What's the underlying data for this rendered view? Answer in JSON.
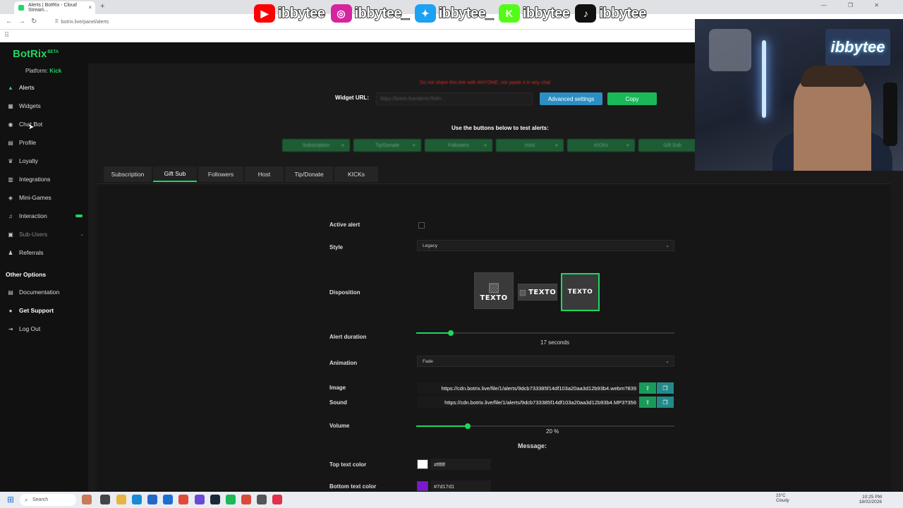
{
  "browser": {
    "tab_title": "Alerts | BotRix - Cloud Stream...",
    "new_tab": "+",
    "tab_close": "×",
    "url": "botrix.live/panel/alerts",
    "window_controls": "— ❐ ✕"
  },
  "social": [
    {
      "icon": "youtube-icon",
      "name": "ibbytee",
      "color": "#ff0000",
      "glyph": "▶"
    },
    {
      "icon": "instagram-icon",
      "name": "ibbytee_",
      "color": "#d6249f",
      "glyph": "◎"
    },
    {
      "icon": "twitter-icon",
      "name": "ibbytee_",
      "color": "#1da1f2",
      "glyph": "✦"
    },
    {
      "icon": "kick-icon",
      "name": "ibbytee",
      "color": "#53fc18",
      "glyph": "K"
    },
    {
      "icon": "tiktok-icon",
      "name": "ibbytee",
      "color": "#111111",
      "glyph": "♪"
    }
  ],
  "webcam": {
    "brand": "ibbytee"
  },
  "app": {
    "logo": "BotRix",
    "logo_badge": "BETA",
    "platform_label": "Platform:",
    "platform_value": "Kick",
    "nav": [
      {
        "label": "Alerts",
        "icon": "triangle-alert-icon",
        "glyph": "▲"
      },
      {
        "label": "Widgets",
        "icon": "widgets-icon",
        "glyph": "▦"
      },
      {
        "label": "Chat Bot",
        "icon": "chat-bot-icon",
        "glyph": "◉"
      },
      {
        "label": "Profile",
        "icon": "profile-icon",
        "glyph": "▤"
      },
      {
        "label": "Loyalty",
        "icon": "trophy-icon",
        "glyph": "♛"
      },
      {
        "label": "Integrations",
        "icon": "integrations-icon",
        "glyph": "▥"
      },
      {
        "label": "Mini-Games",
        "icon": "gamepad-icon",
        "glyph": "◈"
      },
      {
        "label": "Interaction",
        "icon": "interaction-icon",
        "glyph": "♫"
      },
      {
        "label": "Sub-Users",
        "icon": "sub-users-icon",
        "glyph": "▣"
      },
      {
        "label": "Referrals",
        "icon": "referrals-icon",
        "glyph": "♟"
      }
    ],
    "other_options": "Other Options",
    "other_nav": [
      {
        "label": "Documentation",
        "icon": "documentation-icon",
        "glyph": "▤"
      },
      {
        "label": "Get Support",
        "icon": "support-icon",
        "glyph": "●"
      },
      {
        "label": "Log Out",
        "icon": "logout-icon",
        "glyph": "⇥"
      }
    ]
  },
  "widget": {
    "warning": "Do not share this link with ANYONE, nor paste it in any chat",
    "label": "Widget URL:",
    "url_value": "https://botrix.live/alerts?bid=...",
    "advanced": "Advanced settings",
    "copy": "Copy",
    "test_label": "Use the buttons below to test alerts:",
    "test_buttons": [
      "Subscription",
      "Tip/Donate",
      "Followers",
      "Host",
      "KICKs",
      "Gift Sub"
    ]
  },
  "tabs": [
    "Subscription",
    "Gift Sub",
    "Followers",
    "Host",
    "Tip/Donate",
    "KICKs"
  ],
  "active_tab": "Gift Sub",
  "form": {
    "active_alert": "Active alert",
    "style_label": "Style",
    "style_value": "Legacy",
    "disposition_label": "Disposition",
    "disposition_text": "TEXTO",
    "duration_label": "Alert duration",
    "duration_value": "17",
    "duration_unit": "seconds",
    "duration_fraction": 0.135,
    "animation_label": "Animation",
    "animation_value": "Fade",
    "image_label": "Image",
    "image_value": "https://cdn.botrix.live/file/1/alerts/9dcb733385f14df103a20aa3d12b93b4.webm?839",
    "sound_label": "Sound",
    "sound_value": "https://cdn.botrix.live/file/1/alerts/9dcb733385f14df103a20aa3d12b93b4.MP3?356",
    "volume_label": "Volume",
    "volume_value": "20",
    "volume_unit": "%",
    "volume_fraction": 0.2,
    "message_heading": "Message:",
    "top_color_label": "Top text color",
    "top_color_value": "#ffffff",
    "bottom_color_label": "Bottom text color",
    "bottom_color_value": "#7d17d1"
  },
  "taskbar": {
    "search": "Search",
    "weather_temp": "23°C",
    "weather_desc": "Cloudy",
    "time": "10:25 PM",
    "date": "18/02/2026"
  },
  "colors": {
    "accent": "#1ed760",
    "advanced_btn": "#2b8fc4",
    "copy_btn": "#1bb85a"
  }
}
